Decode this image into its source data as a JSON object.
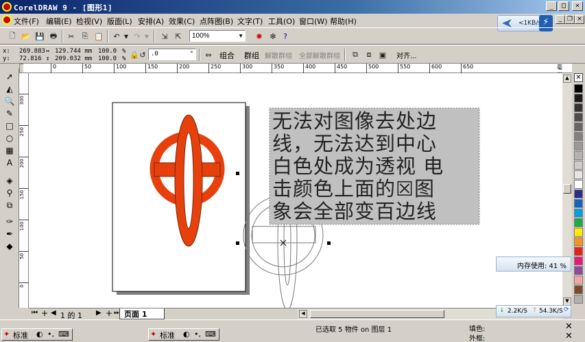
{
  "window": {
    "title": "CorelDRAW 9 - [图形1]"
  },
  "menu": [
    "文件(F)",
    "编辑(E)",
    "检视(V)",
    "版面(L)",
    "安排(A)",
    "效果(C)",
    "点阵图(B)",
    "文字(T)",
    "工具(O)",
    "窗口(W)",
    "帮助(H)"
  ],
  "netmon": {
    "speed": "<1KB/s"
  },
  "toolbar": {
    "zoom": "100%"
  },
  "propbar": {
    "x_label": "x:",
    "y_label": "y:",
    "x": "269.883",
    "y": "72.816",
    "w": "129.744 mm",
    "h": "209.032 mm",
    "sx": "100.0",
    "sy": "100.0",
    "percent": "%",
    "angle": ".0",
    "deg": "°",
    "group": "组合",
    "ungroup": "群组",
    "ungroup_all": "解散群组",
    "ungroup_all2": "全部解散群组",
    "align": "对齐..."
  },
  "ruler": {
    "h": [
      "0",
      "50",
      "100",
      "150",
      "200",
      "250",
      "300",
      "350",
      "400",
      "450",
      "500",
      "550",
      "600",
      "650",
      "毫米"
    ],
    "v": [
      "300",
      "250",
      "200",
      "150",
      "100",
      "50",
      "0"
    ]
  },
  "textbox": {
    "lines": [
      "无法对图像去处边",
      "线，无法达到中心",
      "白色处成为透视 电",
      "击颜色上面的☒图",
      "象会全部变百边线"
    ]
  },
  "pages": {
    "count_text": "1 的 1",
    "tab": "页面 1"
  },
  "status": {
    "selection": "已选取 5 物件 on 图层 1",
    "fill_label": "填色:",
    "outline_label": "外框:"
  },
  "memory": {
    "label": "内存使用: 41 %"
  },
  "net": {
    "down": "2.2K/S",
    "up": "54.3K/S"
  },
  "taskbar": {
    "left_label": "标准",
    "right_label": "标准"
  },
  "palette": [
    "#ffffff",
    "#000000",
    "#1a1a1a",
    "#333333",
    "#4d4d4d",
    "#666666",
    "#808080",
    "#999999",
    "#b3b3b3",
    "#cccccc",
    "#e6e6e6",
    "#ffffff",
    "#2b2b8a",
    "#1565c0",
    "#00a0e0",
    "#1fa843",
    "#ffea00",
    "#f7941d",
    "#e2231a",
    "#e5197a",
    "#8c4a9c",
    "#f4a6a6",
    "#7a4a2a",
    "#b0b0b0",
    "#d0d0d0"
  ]
}
